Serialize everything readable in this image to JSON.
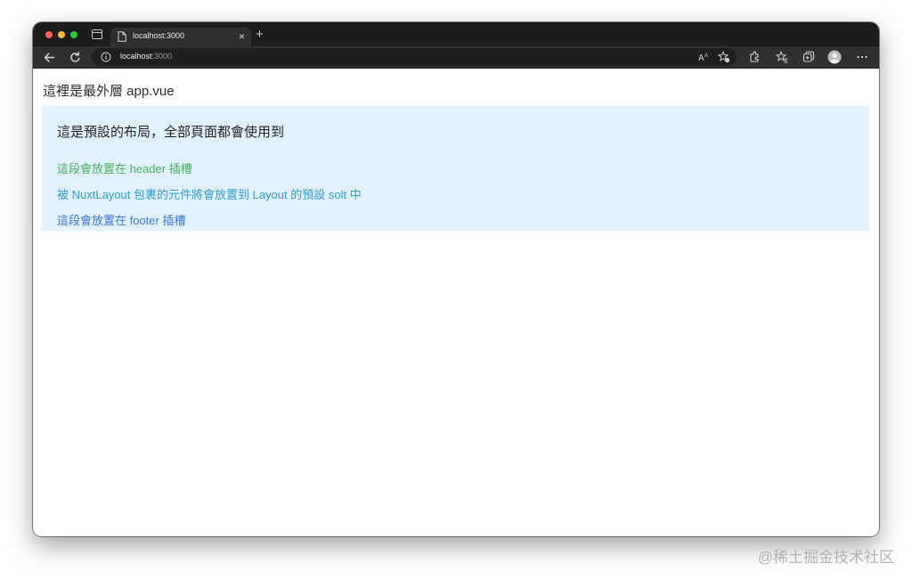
{
  "browser": {
    "tab": {
      "title": "localhost:3000",
      "close_glyph": "×"
    },
    "new_tab_glyph": "+",
    "address": {
      "host": "localhost",
      "port": ":3000"
    },
    "icons": [
      "sidebar-icon",
      "page-icon",
      "back-icon",
      "reload-icon",
      "info-icon",
      "read-aloud-icon",
      "add-favorite-icon",
      "extensions-icon",
      "favorites-icon",
      "collections-icon",
      "profile-icon",
      "more-icon"
    ],
    "more_glyph": "···"
  },
  "page": {
    "app_title": "這裡是最外層 app.vue",
    "layout": {
      "heading": "這是預設的布局，全部頁面都會使用到",
      "header_slot_text": "這段會放置在 header 插槽",
      "default_slot_text": "被 NuxtLayout 包裹的元件將會放置到 Layout 的預設 solt 中",
      "footer_slot_text": "這段會放置在 footer 插槽"
    },
    "colors": {
      "layout_bg": "#e1f1fd",
      "header_slot": "#47b35c",
      "default_slot": "#2f9ed0",
      "footer_slot": "#3a78df"
    }
  },
  "watermark": "@稀土掘金技术社区"
}
